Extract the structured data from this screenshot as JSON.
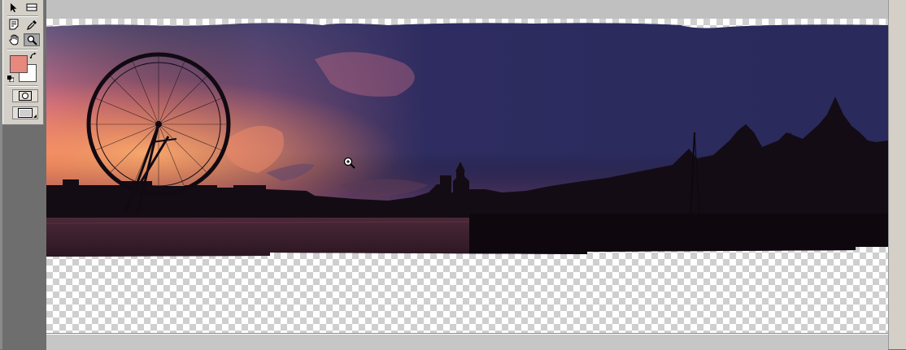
{
  "app": {
    "background": "#6e6e6e",
    "panel_color": "#d4d0c8"
  },
  "toolbox": {
    "tools": [
      {
        "name": "move-tool",
        "icon": "arrow-pointer-icon"
      },
      {
        "name": "eraser-tool",
        "icon": "eraser-icon"
      },
      {
        "name": "notes-tool",
        "icon": "note-icon"
      },
      {
        "name": "eyedropper-tool",
        "icon": "eyedropper-icon"
      },
      {
        "name": "hand-tool",
        "icon": "hand-icon"
      },
      {
        "name": "zoom-tool",
        "icon": "magnifier-icon",
        "active": true
      }
    ],
    "foreground_color": "#e7897e",
    "background_color": "#ffffff",
    "modes": [
      "standard-mode",
      "screen-mode"
    ]
  },
  "canvas": {
    "image_description_icon": "london-panorama-photo",
    "transparency_pattern": "checkerboard",
    "sky_colors": [
      "#2d2c5c",
      "#5b3a6e",
      "#e46a55",
      "#f2b67a"
    ],
    "cursor": "zoom-in-cursor-icon"
  }
}
